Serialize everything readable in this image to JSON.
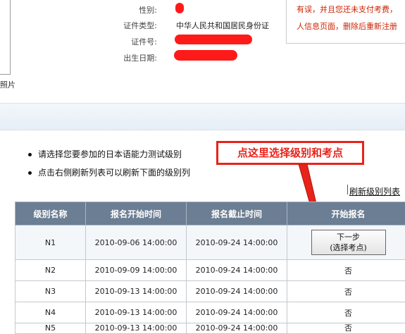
{
  "profile": {
    "photo_caption": "照片",
    "gender_label": "性别:",
    "id_type_label": "证件类型:",
    "id_type_value": "中华人民共和国居民身份证",
    "id_number_label": "证件号:",
    "birth_label": "出生日期:"
  },
  "notice": {
    "line1": "有误，并且您还未支付考费，",
    "line2": "人信息页面，删除后重新注册"
  },
  "instructions": {
    "item1": "请选择您要参加的日本语能力测试级别",
    "item2": "点击右侧刷新列表可以刷新下面的级别列"
  },
  "callout": "点这里选择级别和考点",
  "refresh_link": "刷新级别列表",
  "table": {
    "headers": [
      "级别名称",
      "报名开始时间",
      "报名截止时间",
      "开始报名"
    ],
    "rows": [
      {
        "level": "N1",
        "start": "2010-09-06 14:00:00",
        "end": "2010-09-24 14:00:00",
        "action": ""
      },
      {
        "level": "N2",
        "start": "2010-09-09 14:00:00",
        "end": "2010-09-24 14:00:00",
        "action": "否"
      },
      {
        "level": "N3",
        "start": "2010-09-13 14:00:00",
        "end": "2010-09-24 14:00:00",
        "action": "否"
      },
      {
        "level": "N4",
        "start": "2010-09-13 14:00:00",
        "end": "2010-09-24 14:00:00",
        "action": "否"
      },
      {
        "level": "N5",
        "start": "2010-09-13 14:00:00",
        "end": "2010-09-24 14:00:00",
        "action": "否"
      }
    ],
    "next_button_line1": "下一步",
    "next_button_line2": "(选择考点)"
  },
  "colors": {
    "header_bg": "#6c7e93",
    "annotation_red": "#e8231a",
    "notice_text": "#cc2200"
  }
}
